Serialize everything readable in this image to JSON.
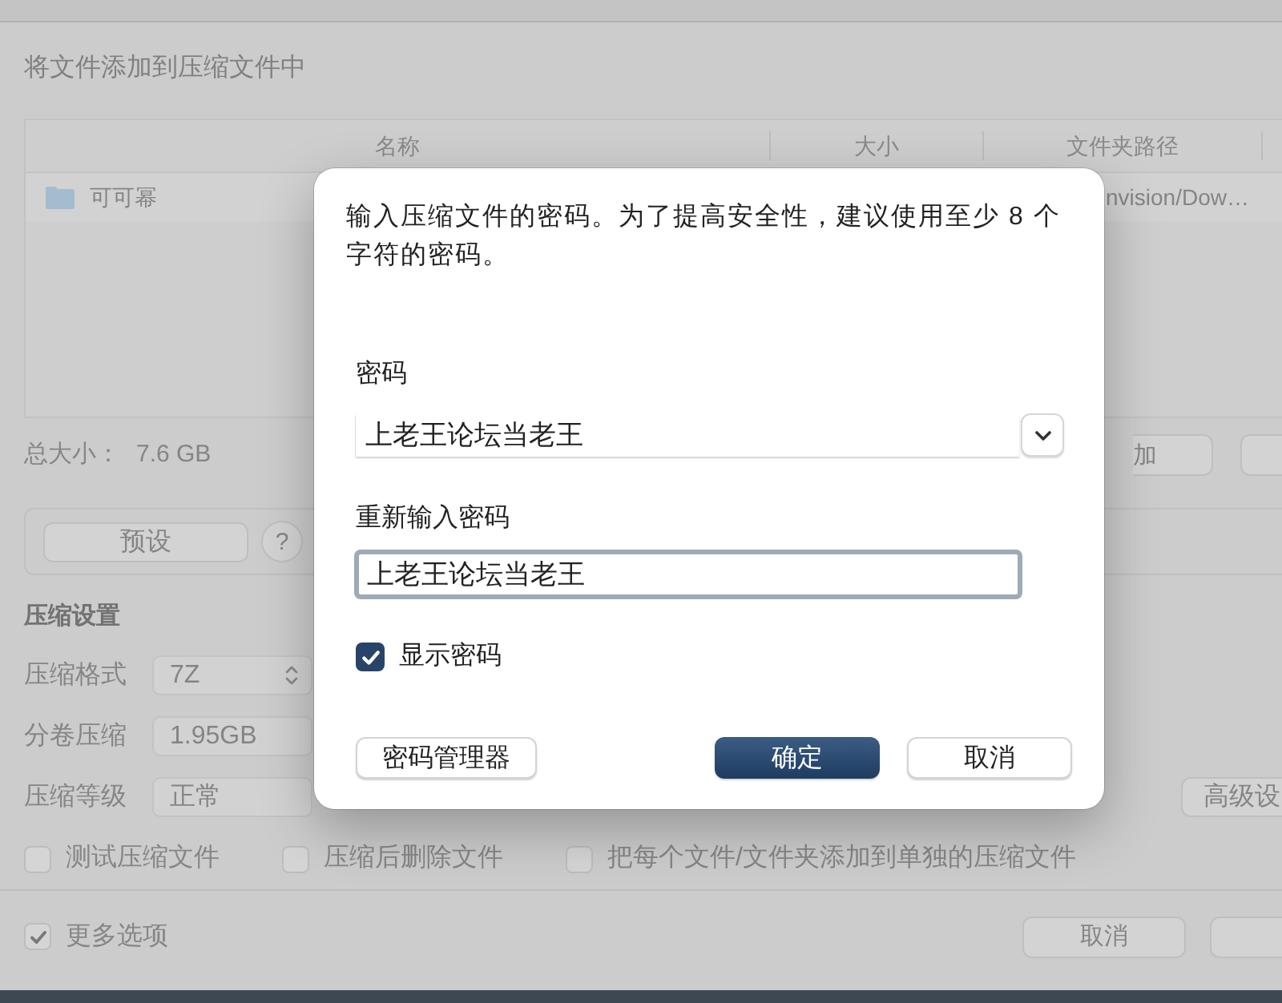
{
  "window": {
    "title": "将文件添加到压缩文件中"
  },
  "file_table": {
    "columns": [
      "名称",
      "大小",
      "文件夹路径"
    ],
    "rows": [
      {
        "name": "可可幂",
        "folder_path": "nvision/Dow…"
      }
    ]
  },
  "table_buttons": [
    {
      "label": "加"
    }
  ],
  "total_size": {
    "label": "总大小：",
    "value": "7.6 GB"
  },
  "preset": {
    "button": "预设",
    "help": "?"
  },
  "compression_settings": {
    "heading": "压缩设置",
    "fields": [
      {
        "label": "压缩格式",
        "kind": "select",
        "value": "7Z"
      },
      {
        "label": "分卷压缩",
        "kind": "field",
        "value": "1.95GB"
      },
      {
        "label": "压缩等级",
        "kind": "field",
        "value": "正常"
      }
    ],
    "advanced_button": "高级设"
  },
  "options": [
    {
      "label": "测试压缩文件",
      "checked": false
    },
    {
      "label": "压缩后删除文件",
      "checked": false
    },
    {
      "label": "把每个文件/文件夹添加到单独的压缩文件",
      "checked": false
    }
  ],
  "more_options": {
    "label": "更多选项",
    "checked": true
  },
  "footer_buttons": [
    {
      "label": "取消"
    }
  ],
  "password_dialog": {
    "message": "输入压缩文件的密码。为了提高安全性，建议使用至少 8 个字符的密码。",
    "fields": [
      {
        "label": "密码",
        "kind": "combo",
        "value": "上老王论坛当老王",
        "focused": false
      },
      {
        "label": "重新输入密码",
        "kind": "text",
        "value": "上老王论坛当老王",
        "focused": true
      }
    ],
    "show_password": {
      "label": "显示密码",
      "checked": true
    },
    "buttons": [
      {
        "label": "密码管理器",
        "kind": "secondary"
      },
      {
        "label": "确定",
        "kind": "primary"
      },
      {
        "label": "取消",
        "kind": "secondary"
      }
    ]
  }
}
